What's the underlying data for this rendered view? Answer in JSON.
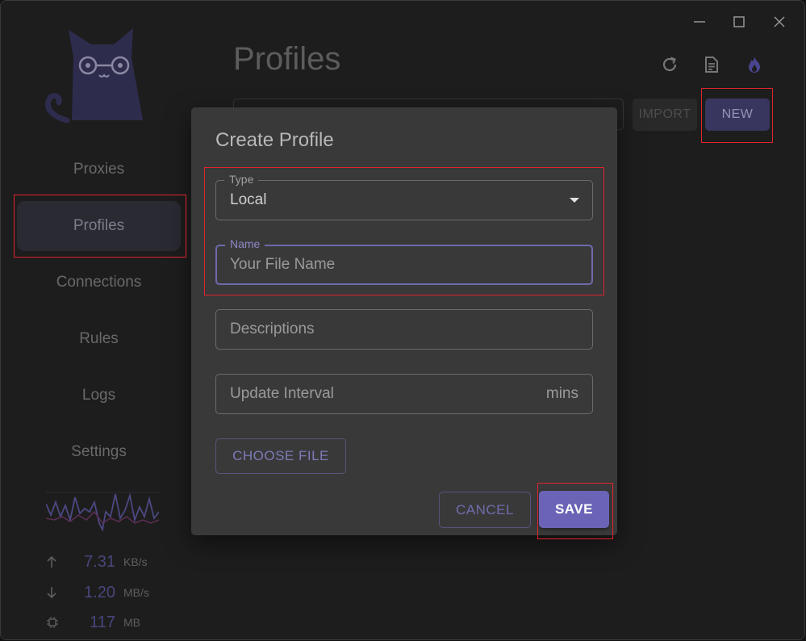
{
  "sidebar": {
    "nav": [
      {
        "label": "Proxies"
      },
      {
        "label": "Profiles"
      },
      {
        "label": "Connections"
      },
      {
        "label": "Rules"
      },
      {
        "label": "Logs"
      },
      {
        "label": "Settings"
      }
    ],
    "active_index": 1,
    "stats": {
      "upload": {
        "value": "7.31",
        "unit": "KB/s",
        "icon": "arrow-up-icon"
      },
      "download": {
        "value": "1.20",
        "unit": "MB/s",
        "icon": "arrow-down-icon"
      },
      "memory": {
        "value": "117",
        "unit": "MB",
        "icon": "memory-chip-icon"
      }
    }
  },
  "header": {
    "title": "Profiles",
    "icons": [
      "refresh-icon",
      "document-icon",
      "fire-icon"
    ]
  },
  "toolbar": {
    "import_label": "IMPORT",
    "new_label": "NEW",
    "url_placeholder": ""
  },
  "dialog": {
    "title": "Create Profile",
    "type_field": {
      "label": "Type",
      "value": "Local"
    },
    "name_field": {
      "label": "Name",
      "placeholder": "Your File Name"
    },
    "desc_field": {
      "placeholder": "Descriptions"
    },
    "interval_field": {
      "placeholder": "Update Interval",
      "suffix": "mins"
    },
    "choose_file_label": "CHOOSE FILE",
    "cancel_label": "CANCEL",
    "save_label": "SAVE"
  },
  "colors": {
    "accent": "#6b64b6",
    "annotation": "#e0242c",
    "background": "#1e1e1e",
    "dialog": "#393939"
  }
}
